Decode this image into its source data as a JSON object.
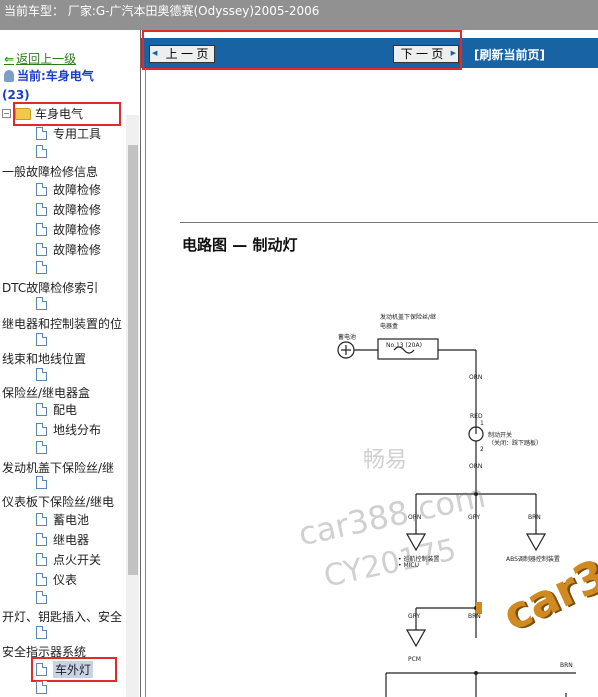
{
  "topbar": {
    "text": "当前车型： 厂家:G-广汽本田奥德赛(Odyssey)2005-2006"
  },
  "sidebar": {
    "back_label": "返回上一级",
    "current_label": "当前:车身电气",
    "count": "(23)",
    "root_label": "车身电气",
    "items": [
      {
        "label": "专用工具"
      },
      {
        "label": ""
      },
      {
        "label": "一般故障检修信息"
      },
      {
        "label": "故障检修"
      },
      {
        "label": "故障检修"
      },
      {
        "label": "故障检修"
      },
      {
        "label": "故障检修"
      },
      {
        "label": ""
      },
      {
        "label": "DTC故障检修索引"
      },
      {
        "label": ""
      },
      {
        "label": "继电器和控制装置的位"
      },
      {
        "label": ""
      },
      {
        "label": "线束和地线位置"
      },
      {
        "label": ""
      },
      {
        "label": "保险丝/继电器盒"
      },
      {
        "label": "配电"
      },
      {
        "label": "地线分布"
      },
      {
        "label": ""
      },
      {
        "label": "发动机盖下保险丝/继"
      },
      {
        "label": ""
      },
      {
        "label": "仪表板下保险丝/继电"
      },
      {
        "label": "蓄电池"
      },
      {
        "label": "继电器"
      },
      {
        "label": "点火开关"
      },
      {
        "label": "仪表"
      },
      {
        "label": ""
      },
      {
        "label": "开灯、钥匙插入、安全"
      },
      {
        "label": ""
      },
      {
        "label": "安全指示器系统"
      },
      {
        "label": "车外灯"
      },
      {
        "label": ""
      }
    ]
  },
  "nav": {
    "prev_label": "上 一 页",
    "next_label": "下 一 页",
    "refresh_label": "[刷新当前页]"
  },
  "diagram": {
    "title": "电路图 — 制动灯",
    "labels": {
      "battery": "蓄电池",
      "fuse_box": "发动机盖下保险丝/继电器盒",
      "fuse": "No.13 (20A)",
      "wire_orn1": "ORN",
      "wire_red": "RED",
      "switch": "制动开关",
      "switch_note": "（关闭：踩下踏板）",
      "wire_orn2": "ORN",
      "wire_orn3": "ORN",
      "wire_gry1": "GRY",
      "wire_brn1": "BRN",
      "ecm_note1": "• 巡航控制装置",
      "ecm_note2": "• MICU",
      "abs_unit": "ABS调制器控制装置",
      "wire_gry2": "GRY",
      "wire_brn2": "BRN",
      "pcm": "PCM",
      "wire_brn3": "BRN",
      "pin1": "1",
      "pin2": "2"
    },
    "watermark_cn": "畅易",
    "watermark_en": "car388.com",
    "watermark_id": "CY20175",
    "logo_text": "car3"
  }
}
